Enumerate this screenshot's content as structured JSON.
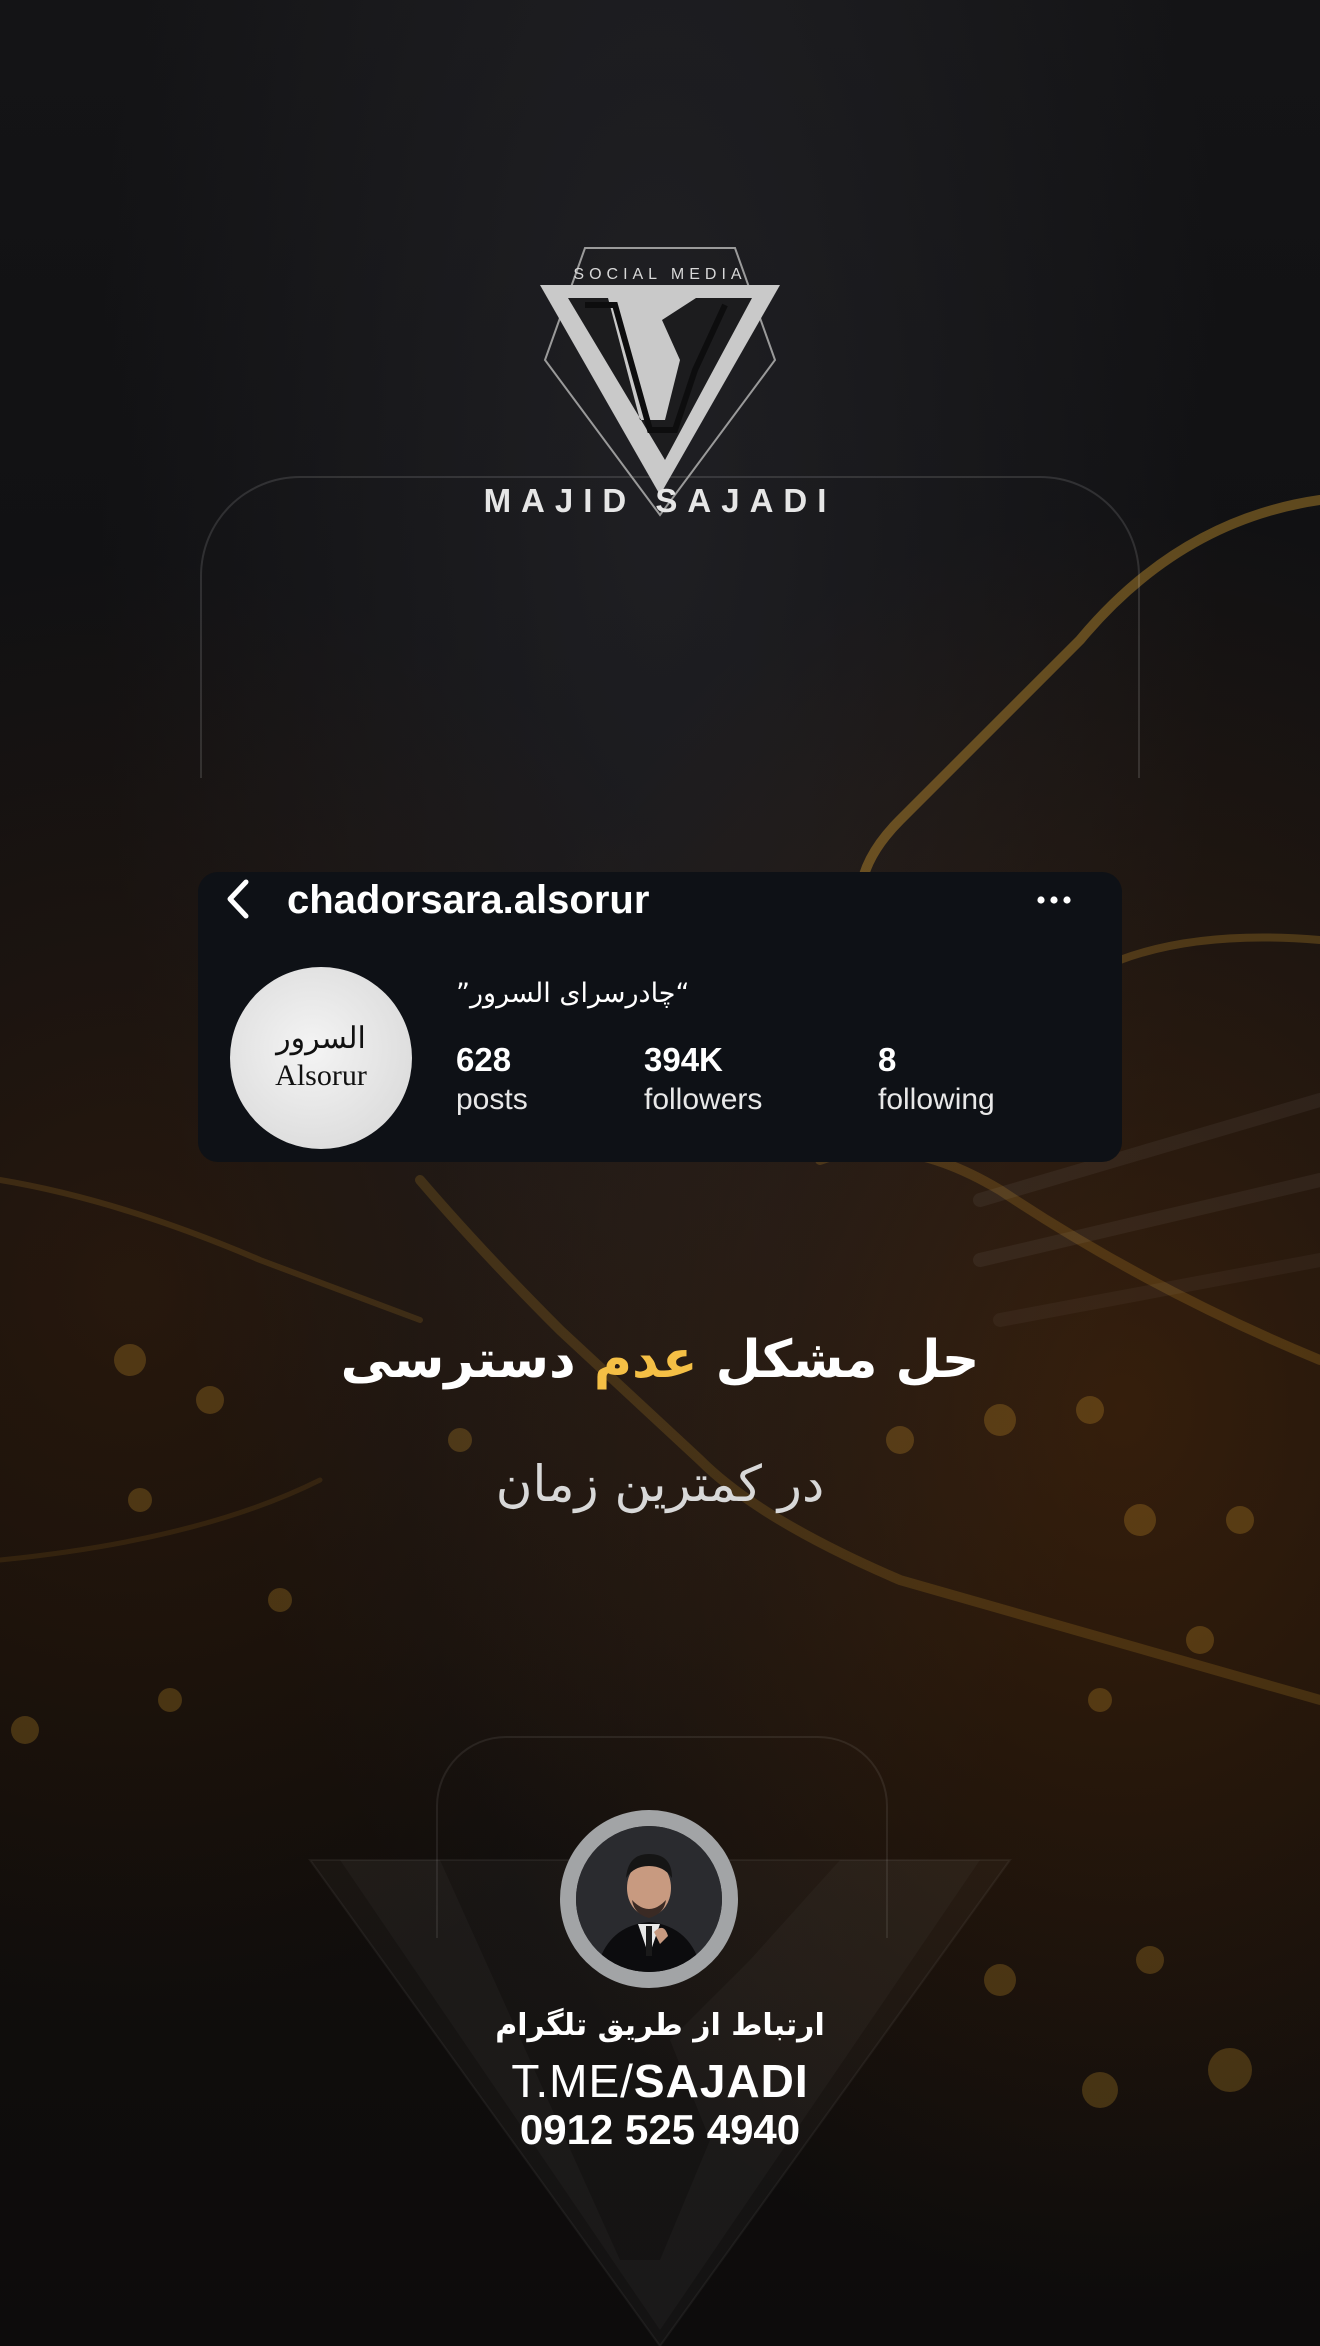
{
  "brand": {
    "subtitle": "SOCIAL MEDIA",
    "name": "MAJID SAJADI",
    "logo_icon": "ms-monogram-logo"
  },
  "instagram": {
    "username": "chadorsara.alsorur",
    "display_name": "“چادرسرای السرور”",
    "profile_logo_arabic": "السرور",
    "profile_logo_latin": "Alsorur",
    "stats": [
      {
        "value": "628",
        "label": "posts"
      },
      {
        "value": "394K",
        "label": "followers"
      },
      {
        "value": "8",
        "label": "following"
      }
    ],
    "icons": {
      "back": "chevron-left-icon",
      "more": "more-horizontal-icon"
    }
  },
  "headline": {
    "part1": "حل مشکل ",
    "accent": "عدم",
    "part2": " دسترسی",
    "accent_color": "#f4bf45"
  },
  "subline": "در کمترین زمان",
  "contact": {
    "title": "ارتباط از طریق تلگرام",
    "link_prefix": "T.ME/",
    "link_user": "SAJADI",
    "phone": "0912 525 4940"
  },
  "colors": {
    "background": "#0b0b0d",
    "card": "#0e1116",
    "accent": "#f4bf45",
    "circuit_glow": "#f2b233"
  }
}
